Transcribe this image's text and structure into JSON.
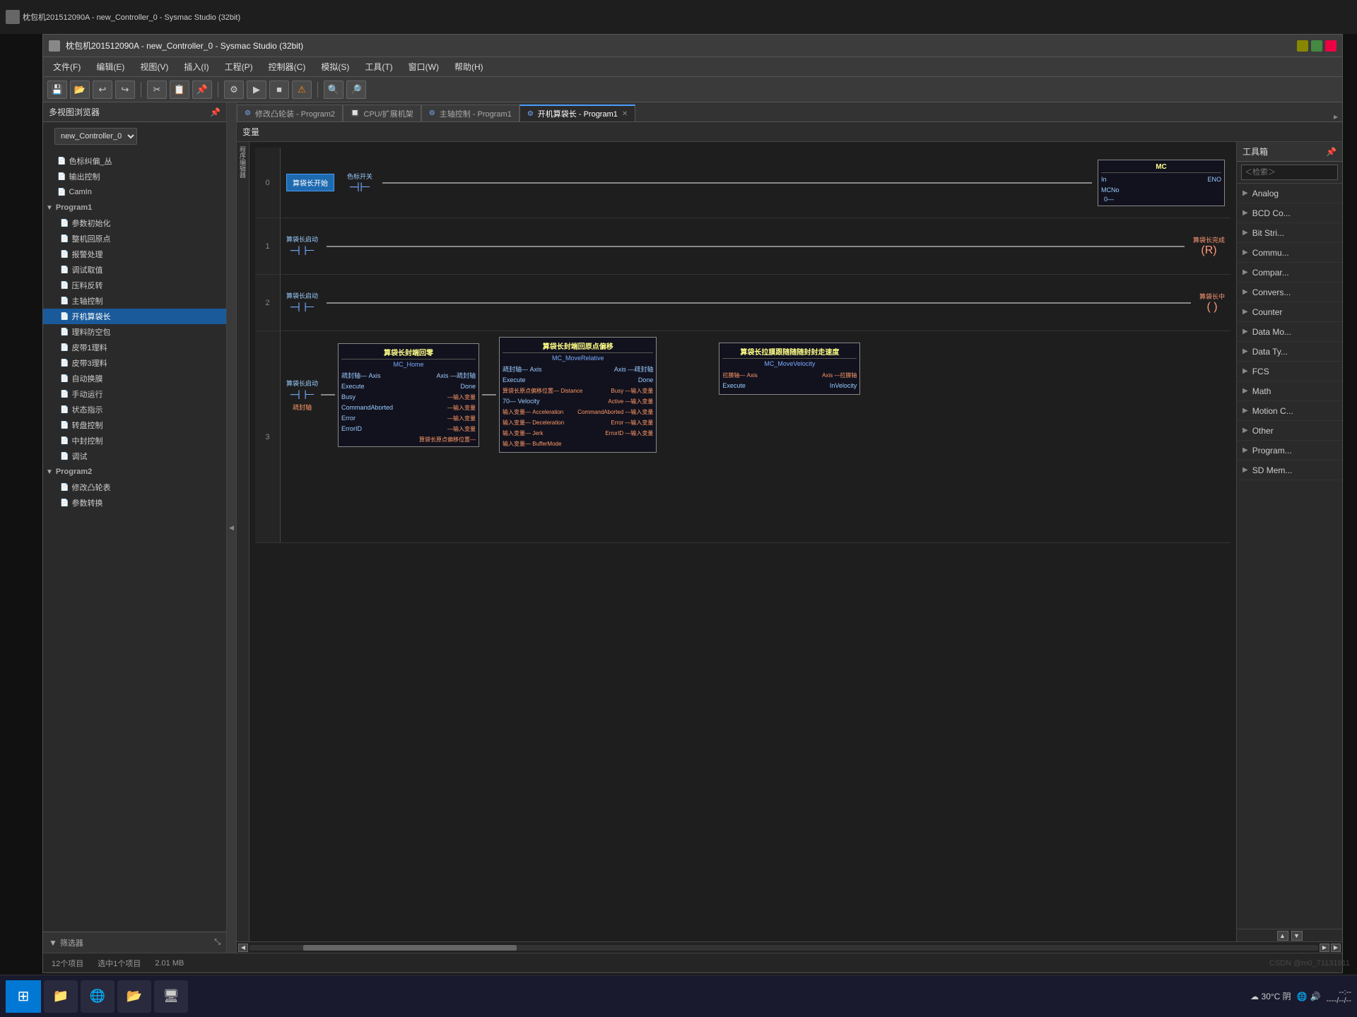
{
  "app": {
    "title": "枕包机201512090A - new_Controller_0 - Sysmac Studio (32bit)",
    "file_label": "文件",
    "background": "#1a1a1a"
  },
  "window": {
    "title": "枕包机201512090A - new_Controller_0 - Sysmac Studio (32bit)"
  },
  "menu": {
    "items": [
      "文件(F)",
      "编辑(E)",
      "视图(V)",
      "插入(I)",
      "工程(P)",
      "控制器(C)",
      "模拟(S)",
      "工具(T)",
      "窗口(W)",
      "帮助(H)"
    ]
  },
  "tabs": [
    {
      "label": "修改凸轮装 - Program2",
      "active": false,
      "icon": "⚙"
    },
    {
      "label": "CPU/扩展机架",
      "active": false,
      "icon": "🔲"
    },
    {
      "label": "主轴控制 - Program1",
      "active": false,
      "icon": "⚙"
    },
    {
      "label": "开机算袋长 - Program1",
      "active": true,
      "icon": "⚙",
      "closeable": true
    }
  ],
  "sidebar": {
    "title": "多视图浏览器",
    "controller": "new_Controller_0",
    "tree_items": [
      {
        "label": "色标纠偏_丛",
        "indent": 1,
        "icon": "📄"
      },
      {
        "label": "输出控制",
        "indent": 1,
        "icon": "📄"
      },
      {
        "label": "CamIn",
        "indent": 1,
        "icon": "📄"
      },
      {
        "label": "Program1",
        "indent": 0,
        "icon": "▼",
        "section": true
      },
      {
        "label": "参数初始化",
        "indent": 1,
        "icon": "📄"
      },
      {
        "label": "整机回原点",
        "indent": 1,
        "icon": "📄"
      },
      {
        "label": "报警处理",
        "indent": 1,
        "icon": "📄"
      },
      {
        "label": "调试取值",
        "indent": 1,
        "icon": "📄"
      },
      {
        "label": "压料反转",
        "indent": 1,
        "icon": "📄"
      },
      {
        "label": "主轴控制",
        "indent": 1,
        "icon": "📄"
      },
      {
        "label": "开机算袋长",
        "indent": 1,
        "icon": "📄",
        "selected": true
      },
      {
        "label": "理料防空包",
        "indent": 1,
        "icon": "📄"
      },
      {
        "label": "皮带1理料",
        "indent": 1,
        "icon": "📄"
      },
      {
        "label": "皮带3理料",
        "indent": 1,
        "icon": "📄"
      },
      {
        "label": "自动换膜",
        "indent": 1,
        "icon": "📄"
      },
      {
        "label": "手动运行",
        "indent": 1,
        "icon": "📄"
      },
      {
        "label": "状态指示",
        "indent": 1,
        "icon": "📄"
      },
      {
        "label": "转盘控制",
        "indent": 1,
        "icon": "📄"
      },
      {
        "label": "中封控制",
        "indent": 1,
        "icon": "📄"
      },
      {
        "label": "调试",
        "indent": 1,
        "icon": "📄"
      },
      {
        "label": "Program2",
        "indent": 0,
        "icon": "▼",
        "section": true
      },
      {
        "label": "修改凸轮表",
        "indent": 1,
        "icon": "📄"
      },
      {
        "label": "参数转换",
        "indent": 1,
        "icon": "📄"
      }
    ],
    "footer": "筛选器"
  },
  "editor": {
    "var_label": "变量",
    "rungs": [
      {
        "number": "0",
        "elements": [
          {
            "type": "blue_block",
            "label": "算袋长开始"
          },
          {
            "type": "contact",
            "label": "色标开关"
          },
          {
            "type": "wire"
          },
          {
            "type": "mc_block",
            "title": "MC",
            "pins_left": [
              "In"
            ],
            "pins_right": [
              "ENO"
            ],
            "bottom": "MCNo",
            "bottom_val": "0"
          }
        ]
      },
      {
        "number": "1",
        "above": "算袋长启动",
        "elements": [
          {
            "type": "contact_no",
            "label": ""
          },
          {
            "type": "wire"
          },
          {
            "type": "coil_r",
            "label": "算袋长完成"
          }
        ]
      },
      {
        "number": "2",
        "above": "算袋长启动",
        "elements": [
          {
            "type": "contact_no",
            "label": ""
          },
          {
            "type": "wire"
          },
          {
            "type": "coil",
            "label": "算袋长中"
          }
        ]
      },
      {
        "number": "3",
        "above": "算袋长封端回零",
        "has_blocks": true,
        "block1": {
          "title": "算袋长封端回零",
          "sub": "MC_Home",
          "inputs": [
            "Axis",
            "Execute",
            "CommandAborted",
            "Error",
            "ErrorID"
          ],
          "outputs": [
            "Axis",
            "Done",
            "Busy—输入变量",
            "Busy—输入变量",
            "—输入变量",
            "—输入变量"
          ],
          "left_labels": [
            "疏封轴—",
            "算袋长启动",
            "",
            "",
            "",
            ""
          ],
          "right_labels": [
            "—疏封轴",
            "",
            "算袋长原点偏移位置—",
            "",
            "",
            ""
          ]
        },
        "block2": {
          "title": "算袋长封端回原点偏移",
          "sub": "MC_MoveRelative",
          "inputs": [
            "Axis",
            "Execute",
            "Distance",
            "Velocity",
            "Acceleration",
            "Deceleration",
            "Jerk",
            "BufferMode"
          ],
          "outputs": [
            "Axis",
            "Done",
            "Busy",
            "Active",
            "CommandAborted",
            "Error",
            "ErrorID"
          ],
          "left_labels": [
            "疏封轴—",
            "",
            "算袋长原点偏移位置—",
            "70—",
            "输入变量—",
            "输入变量—",
            "输入变量—",
            "输入变量—"
          ],
          "right_labels": [
            "—疏封轴",
            "",
            "—输入变量",
            "—输入变量",
            "—输入变量",
            "—输入变量",
            "—输入变量",
            ""
          ]
        }
      }
    ]
  },
  "toolbox": {
    "title": "工具箱",
    "search_placeholder": "＜检索＞",
    "items": [
      {
        "label": "Analog",
        "has_arrow": true
      },
      {
        "label": "BCD Co...",
        "has_arrow": true
      },
      {
        "label": "Bit Stri...",
        "has_arrow": true
      },
      {
        "label": "Commu...",
        "has_arrow": true
      },
      {
        "label": "Compar...",
        "has_arrow": true
      },
      {
        "label": "Convers...",
        "has_arrow": true
      },
      {
        "label": "Counter",
        "has_arrow": true
      },
      {
        "label": "Data Mo...",
        "has_arrow": true
      },
      {
        "label": "Data Ty...",
        "has_arrow": true
      },
      {
        "label": "FCS",
        "has_arrow": true
      },
      {
        "label": "Math",
        "has_arrow": true
      },
      {
        "label": "Motion C...",
        "has_arrow": true
      },
      {
        "label": "Other",
        "has_arrow": true
      },
      {
        "label": "Program...",
        "has_arrow": true
      },
      {
        "label": "SD Mem...",
        "has_arrow": true
      }
    ]
  },
  "status_bar": {
    "items_count": "12个项目",
    "selected": "选中1个项目",
    "size": "2.01 MB"
  },
  "taskbar": {
    "start_icon": "⊞",
    "items": [
      "📁",
      "🌐",
      "📂",
      "🖥"
    ],
    "time": "30°C 阴",
    "watermark": "CSDN @m0_71131911"
  }
}
